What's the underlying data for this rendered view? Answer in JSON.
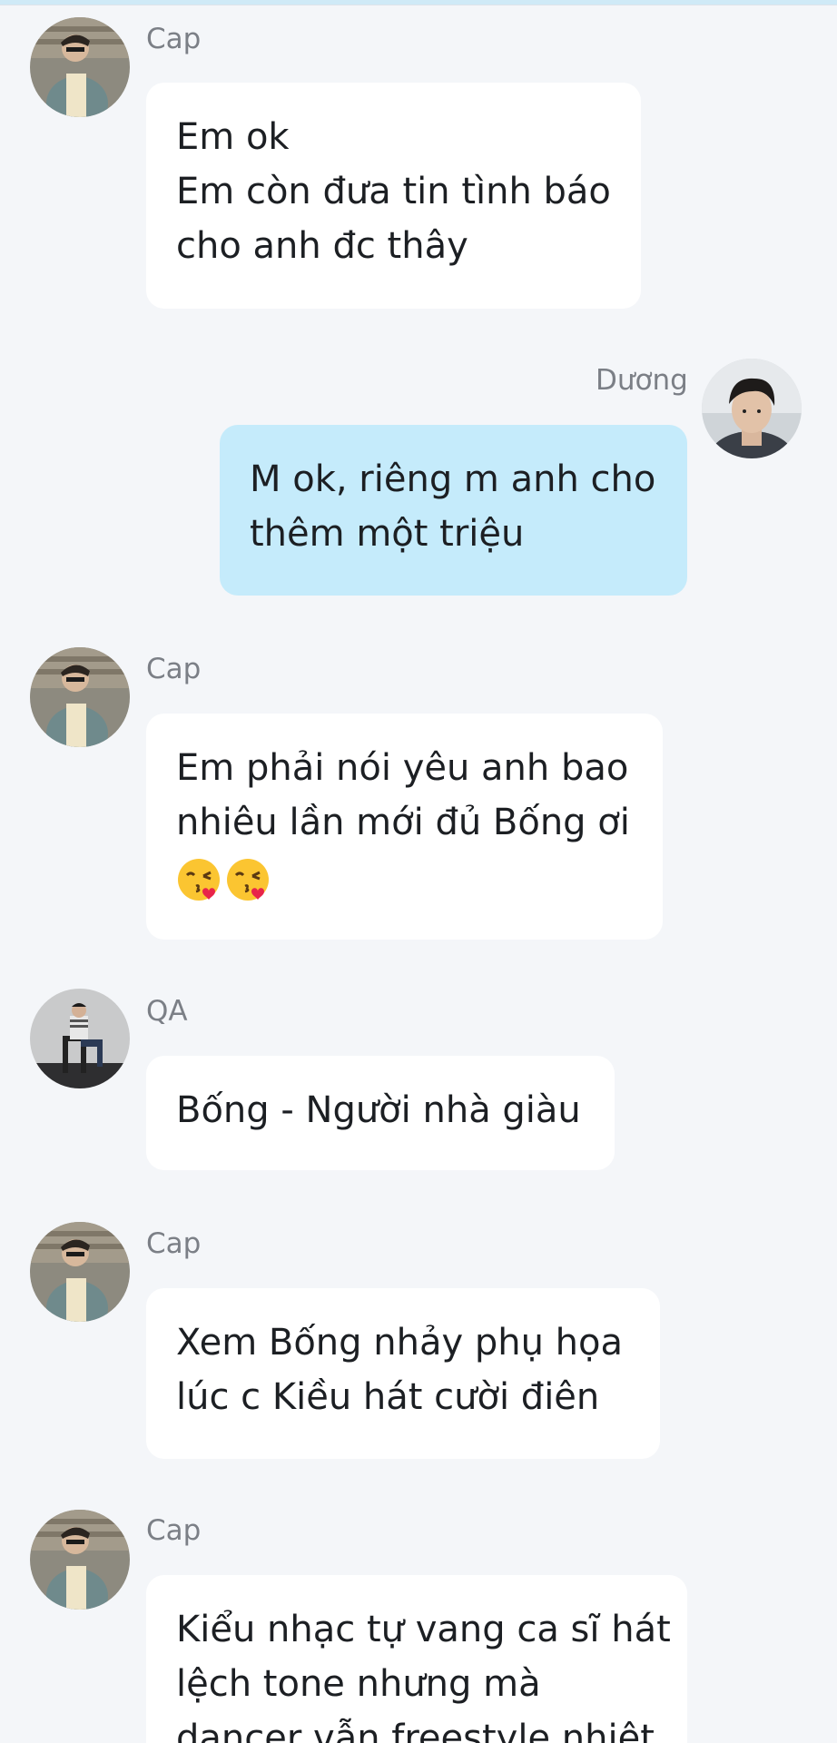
{
  "messages": [
    {
      "sender": "Cap",
      "avatar": "cap-avatar",
      "lines": [
        "Em ok",
        "Em còn đưa tin tình báo",
        "cho anh đc thây"
      ]
    },
    {
      "sender": "Dương",
      "avatar": "duong-avatar",
      "lines": [
        "M ok, riêng m anh cho",
        "thêm một triệu"
      ]
    },
    {
      "sender": "Cap",
      "avatar": "cap-avatar",
      "lines": [
        "Em phải nói yêu anh bao",
        "nhiêu lần mới đủ Bống ơi"
      ],
      "emojis": [
        "kissing-face-with-heart-emoji",
        "kissing-face-with-heart-emoji"
      ]
    },
    {
      "sender": "QA",
      "avatar": "qa-avatar",
      "lines": [
        "Bống - Người nhà giàu"
      ]
    },
    {
      "sender": "Cap",
      "avatar": "cap-avatar",
      "lines": [
        "Xem Bống nhảy phụ họa",
        "lúc c Kiều hát cười điên"
      ]
    },
    {
      "sender": "Cap",
      "avatar": "cap-avatar",
      "lines": [
        "Kiểu nhạc tự vang ca sĩ hát",
        "lệch tone nhưng mà",
        "dancer vẫn freestyle nhiệt"
      ]
    }
  ],
  "colors": {
    "background": "#f4f6f9",
    "bubble_other": "#ffffff",
    "bubble_self": "#c5ebfb",
    "name_text": "#7b7f86",
    "message_text": "#1c1f23"
  }
}
